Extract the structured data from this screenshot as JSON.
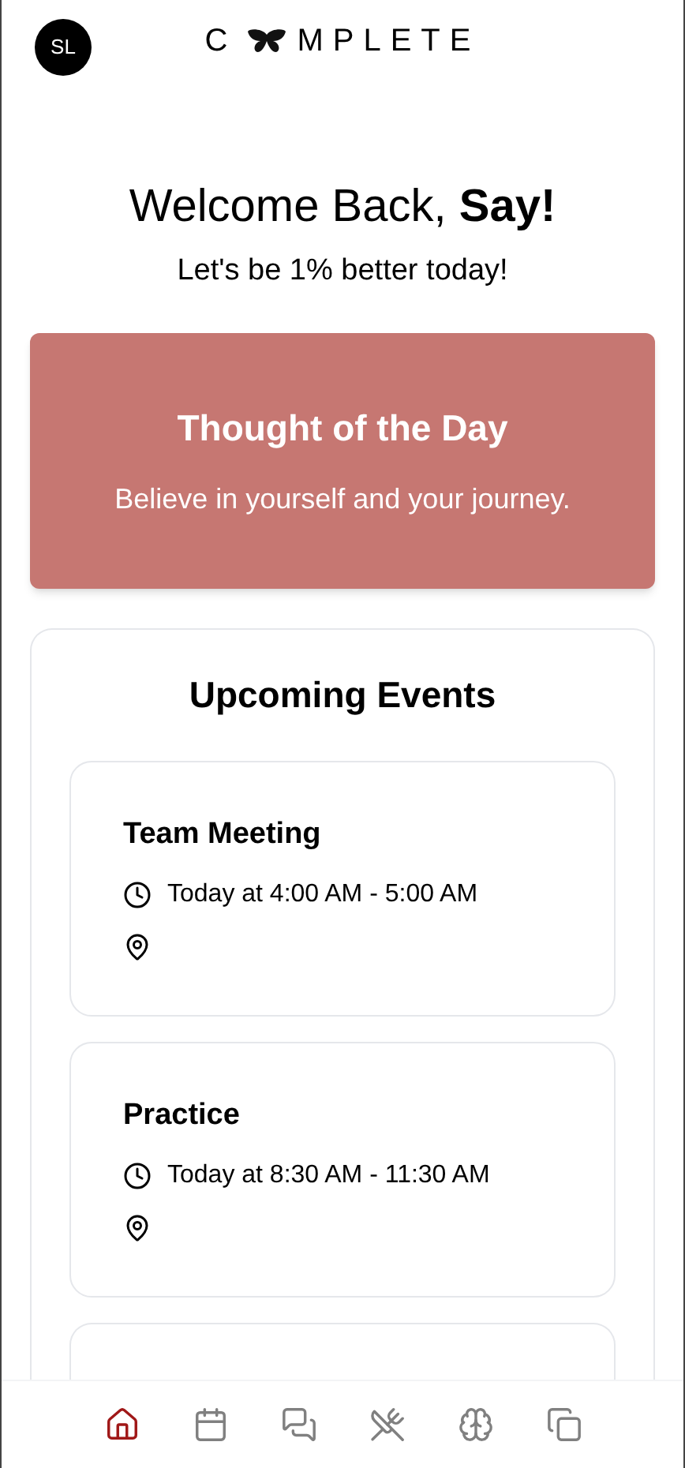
{
  "header": {
    "avatar": "SL",
    "logo": {
      "before": "C",
      "after": "MPLETE"
    }
  },
  "greeting": {
    "title": "Welcome Back, **Say!**",
    "subtitle": "Let's be 1% better today!"
  },
  "thought": {
    "title": "Thought of the Day",
    "text": "Believe in yourself and your journey."
  },
  "events": {
    "title": "Upcoming Events",
    "items": [
      {
        "name": "Team Meeting",
        "time": "Today at 4:00 AM - 5:00 AM"
      },
      {
        "name": "Practice",
        "time": "Today at 8:30 AM - 11:30 AM"
      }
    ]
  },
  "nav": [
    {
      "kind": "home",
      "selected": true
    },
    {
      "kind": "calendar",
      "selected": false
    },
    {
      "kind": "chat",
      "selected": false
    },
    {
      "kind": "food",
      "selected": false
    },
    {
      "kind": "brain",
      "selected": false
    },
    {
      "kind": "files",
      "selected": false
    }
  ]
}
